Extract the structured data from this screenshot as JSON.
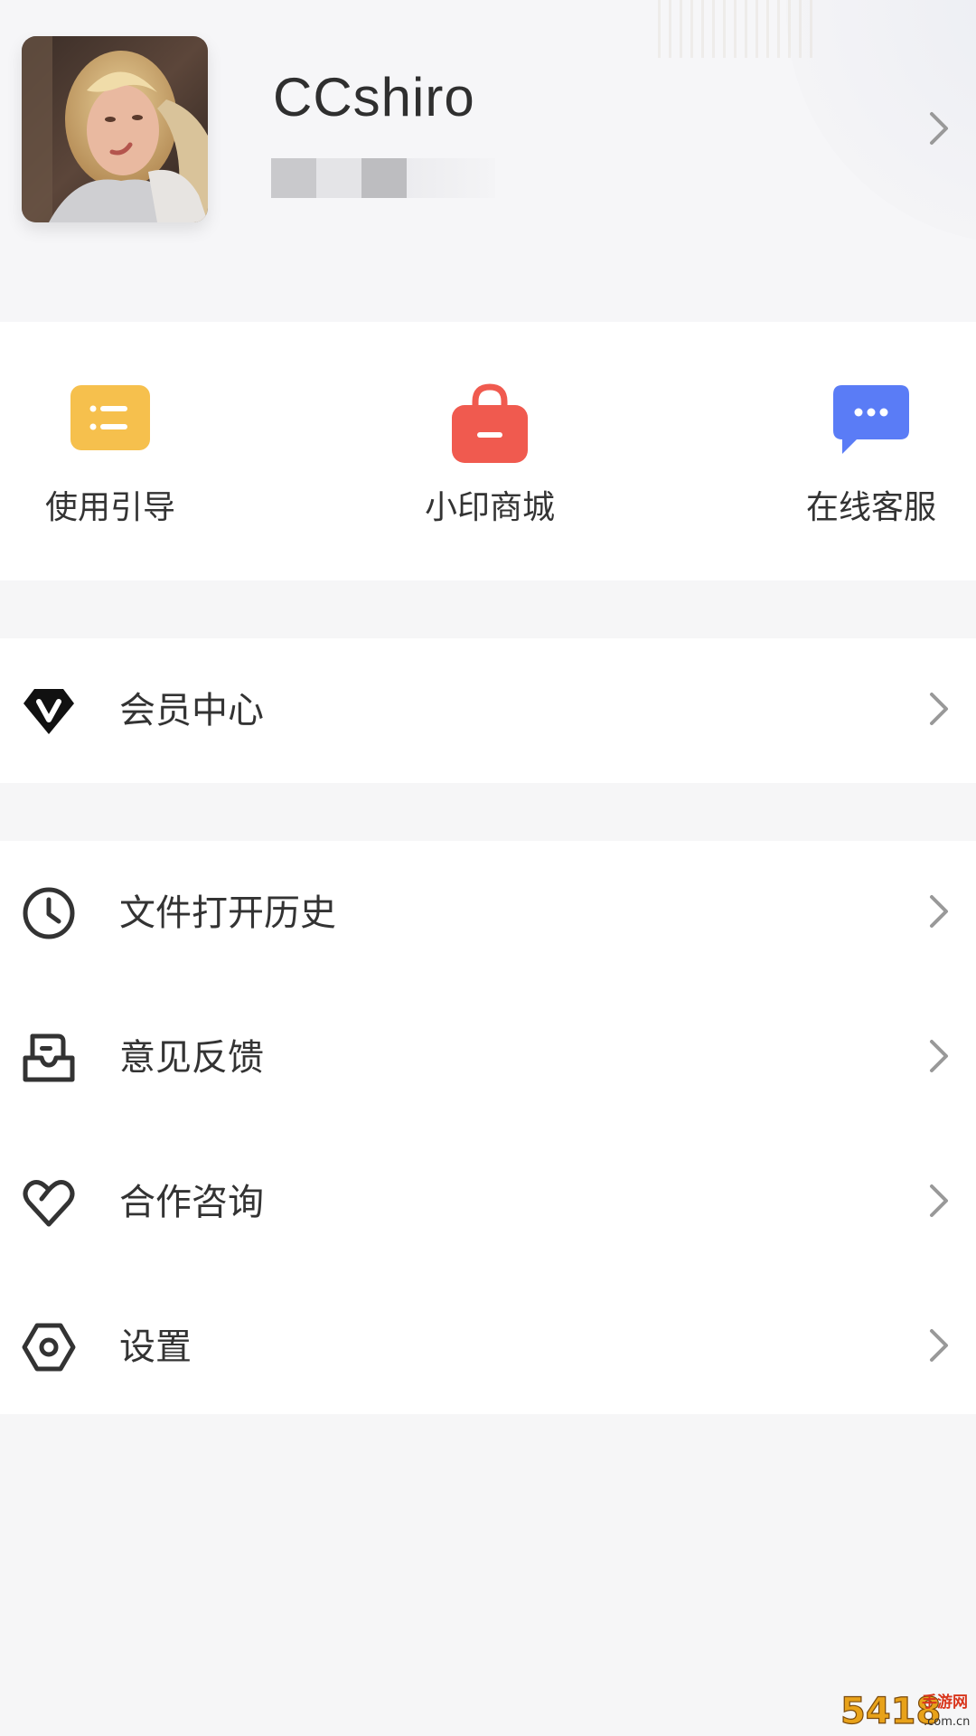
{
  "profile": {
    "username": "CCshiro",
    "avatar_icon": "user-avatar-photo"
  },
  "quick_actions": [
    {
      "label": "使用引导",
      "icon": "list-icon",
      "color": "#f6c04d"
    },
    {
      "label": "小印商城",
      "icon": "shopping-bag-icon",
      "color": "#f05a4f"
    },
    {
      "label": "在线客服",
      "icon": "chat-bubble-icon",
      "color": "#5a7cf6"
    }
  ],
  "vip_row": {
    "label": "会员中心",
    "icon": "vip-diamond-icon"
  },
  "menu_rows": [
    {
      "label": "文件打开历史",
      "icon": "clock-icon"
    },
    {
      "label": "意见反馈",
      "icon": "feedback-box-icon"
    },
    {
      "label": "合作咨询",
      "icon": "heart-icon"
    },
    {
      "label": "设置",
      "icon": "hexagon-settings-icon"
    }
  ],
  "watermark": {
    "logo_text": "5418",
    "site_text": "手游网",
    "domain": ".com.cn"
  },
  "colors": {
    "background": "#f6f6f7",
    "card": "#ffffff",
    "text": "#333333",
    "chevron": "#999999"
  }
}
